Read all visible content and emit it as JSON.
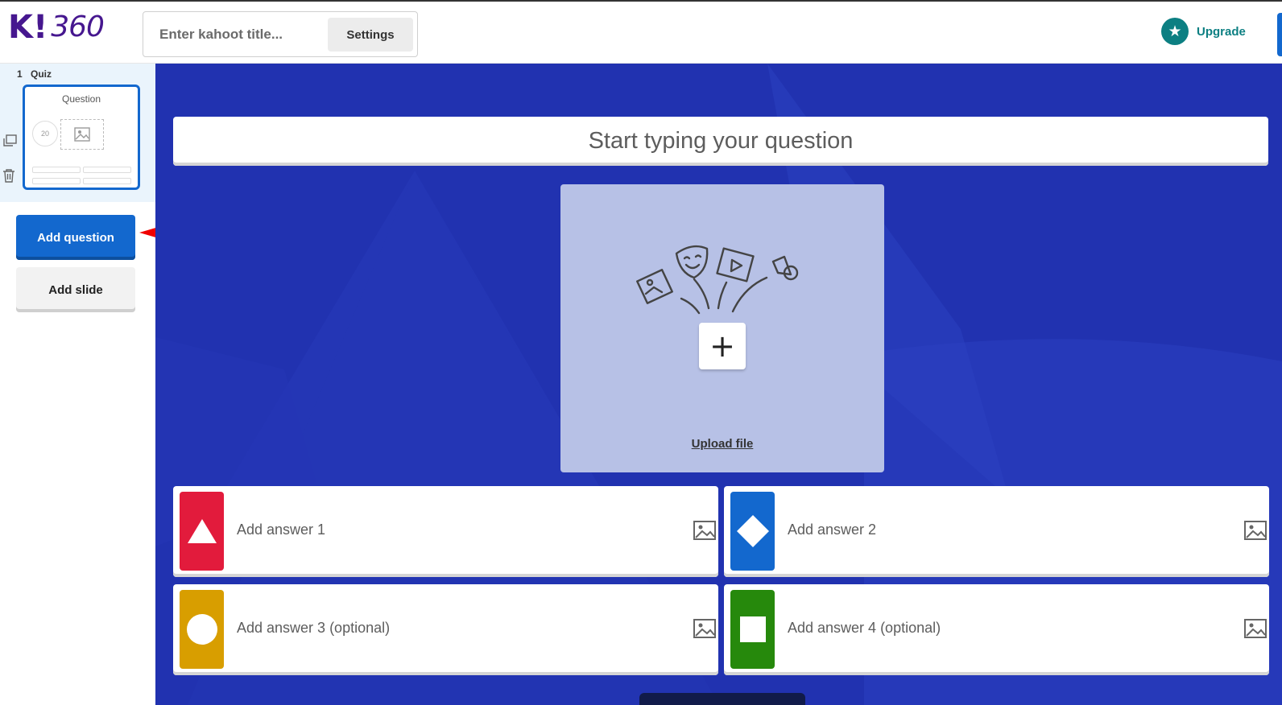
{
  "app": {
    "logo_text": "K!",
    "logo_suffix": "360"
  },
  "header": {
    "title_placeholder": "Enter kahoot title...",
    "settings_label": "Settings",
    "upgrade_label": "Upgrade",
    "upgrade_icon": "star-icon"
  },
  "sidebar": {
    "slide_number": "1",
    "slide_type": "Quiz",
    "thumb_title": "Question",
    "thumb_timer": "20",
    "add_question_label": "Add question",
    "add_slide_label": "Add slide"
  },
  "editor": {
    "question_placeholder": "Start typing your question",
    "upload_label": "Upload file",
    "answers": [
      {
        "placeholder": "Add answer 1",
        "shape": "triangle",
        "color": "#e21b3c"
      },
      {
        "placeholder": "Add answer 2",
        "shape": "diamond",
        "color": "#1368ce"
      },
      {
        "placeholder": "Add answer 3 (optional)",
        "shape": "circle",
        "color": "#d89e00"
      },
      {
        "placeholder": "Add answer 4 (optional)",
        "shape": "square",
        "color": "#26890c"
      }
    ]
  },
  "colors": {
    "brand": "#46178f",
    "canvas_bg": "#2132b0",
    "accent_blue": "#1368ce",
    "upgrade_teal": "#0c7f82"
  }
}
